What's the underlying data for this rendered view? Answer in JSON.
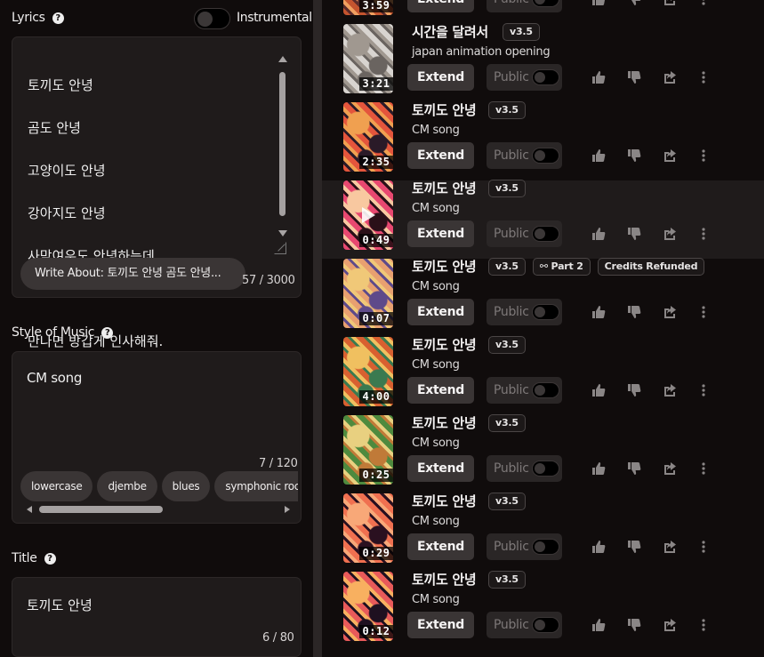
{
  "lyrics": {
    "label": "Lyrics",
    "help_icon": "?",
    "instrumental_label": "Instrumental",
    "lines": [
      "토끼도 안녕",
      "곰도 안녕",
      "고양이도 안녕",
      "강아지도 안녕",
      "사막여우도 안녕하는데",
      "",
      "만나면 방갑게 인사해줘."
    ],
    "write_about": "Write About: 토끼도 안녕 곰도 안녕...",
    "counter": "57 / 3000"
  },
  "style": {
    "label": "Style of Music",
    "help_icon": "?",
    "value": "CM song",
    "counter": "7 / 120",
    "chips": [
      "lowercase",
      "djembe",
      "blues",
      "symphonic rock"
    ]
  },
  "title": {
    "label": "Title",
    "help_icon": "?",
    "value": "토끼도 안녕",
    "counter": "6 / 80"
  },
  "songs": [
    {
      "title": "",
      "version": "",
      "style": "",
      "duration": "3:59",
      "tags": [],
      "palette": [
        "#c4542f",
        "#5a2a2a",
        "#f0a060"
      ]
    },
    {
      "title": "시간을 달려서",
      "version": "v3.5",
      "style": "japan animation opening",
      "duration": "3:21",
      "tags": [],
      "palette": [
        "#d8d4d0",
        "#6a6460",
        "#a09890"
      ]
    },
    {
      "title": "토끼도 안녕",
      "version": "v3.5",
      "style": "CM song",
      "duration": "2:35",
      "tags": [],
      "palette": [
        "#e4553c",
        "#2a1a28",
        "#f0a050"
      ]
    },
    {
      "title": "토끼도 안녕",
      "version": "v3.5",
      "style": "CM song",
      "duration": "0:49",
      "tags": [],
      "palette": [
        "#e84870",
        "#2a1018",
        "#f8c8a0"
      ]
    },
    {
      "title": "토끼도 안녕",
      "version": "v3.5",
      "style": "CM song",
      "duration": "0:07",
      "tags": [
        "Part 2",
        "Credits Refunded"
      ],
      "palette": [
        "#e8a070",
        "#5e4a8a",
        "#f0c878"
      ]
    },
    {
      "title": "토끼도 안녕",
      "version": "v3.5",
      "style": "CM song",
      "duration": "4:00",
      "tags": [],
      "palette": [
        "#d86030",
        "#3a7a50",
        "#f0c060"
      ]
    },
    {
      "title": "토끼도 안녕",
      "version": "v3.5",
      "style": "CM song",
      "duration": "0:25",
      "tags": [],
      "palette": [
        "#4e8a3e",
        "#c07a38",
        "#e8d080"
      ]
    },
    {
      "title": "토끼도 안녕",
      "version": "v3.5",
      "style": "CM song",
      "duration": "0:29",
      "tags": [],
      "palette": [
        "#f07050",
        "#2a1020",
        "#f8a878"
      ]
    },
    {
      "title": "토끼도 안녕",
      "version": "v3.5",
      "style": "CM song",
      "duration": "0:12",
      "tags": [],
      "palette": [
        "#e85a5a",
        "#1e1020",
        "#f8b060"
      ]
    }
  ],
  "song_actions": {
    "extend_label": "Extend",
    "public_label": "Public",
    "icons": [
      "thumbs-up-icon",
      "thumbs-down-icon",
      "share-icon",
      "more-icon"
    ]
  },
  "colors": {
    "background": "#100c0c",
    "panel": "#1f1b1b",
    "button": "#3a3535",
    "spellcheck": "#d23232"
  }
}
